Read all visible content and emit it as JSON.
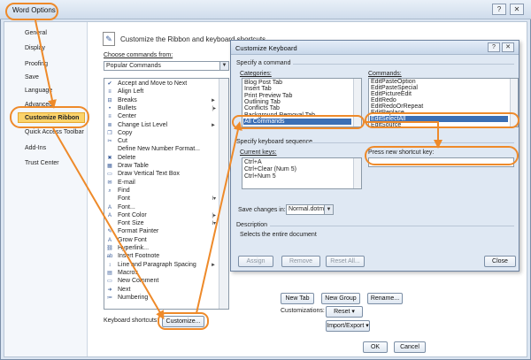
{
  "window": {
    "title": "Word Options",
    "help_glyph": "?",
    "close_glyph": "✕"
  },
  "nav": {
    "items": [
      "General",
      "Display",
      "Proofing",
      "Save",
      "Language",
      "Advanced",
      "Customize Ribbon",
      "Quick Access Toolbar",
      "Add-Ins",
      "Trust Center"
    ],
    "selected": "Customize Ribbon"
  },
  "main": {
    "heading": "Customize the Ribbon and keyboard shortcuts.",
    "choose_label": "Choose commands from:",
    "choose_value": "Popular Commands",
    "commands": [
      {
        "label": "Accept and Move to Next",
        "icon": "accept-icon",
        "glyph": "✔",
        "sub": ""
      },
      {
        "label": "Align Left",
        "icon": "align-left-icon",
        "glyph": "≡",
        "sub": ""
      },
      {
        "label": "Breaks",
        "icon": "breaks-icon",
        "glyph": "⊟",
        "sub": "►"
      },
      {
        "label": "Bullets",
        "icon": "bullets-icon",
        "glyph": "•",
        "sub": "|▸"
      },
      {
        "label": "Center",
        "icon": "center-icon",
        "glyph": "≡",
        "sub": ""
      },
      {
        "label": "Change List Level",
        "icon": "list-level-icon",
        "glyph": "≣",
        "sub": "►"
      },
      {
        "label": "Copy",
        "icon": "copy-icon",
        "glyph": "❐",
        "sub": ""
      },
      {
        "label": "Cut",
        "icon": "cut-icon",
        "glyph": "✂",
        "sub": ""
      },
      {
        "label": "Define New Number Format...",
        "icon": "",
        "glyph": "",
        "sub": ""
      },
      {
        "label": "Delete",
        "icon": "delete-icon",
        "glyph": "✖",
        "sub": ""
      },
      {
        "label": "Draw Table",
        "icon": "draw-table-icon",
        "glyph": "▦",
        "sub": ""
      },
      {
        "label": "Draw Vertical Text Box",
        "icon": "text-box-icon",
        "glyph": "▭",
        "sub": ""
      },
      {
        "label": "E-mail",
        "icon": "email-icon",
        "glyph": "✉",
        "sub": ""
      },
      {
        "label": "Find",
        "icon": "find-icon",
        "glyph": "⌕",
        "sub": ""
      },
      {
        "label": "Font",
        "icon": "",
        "glyph": "",
        "sub": "I▾"
      },
      {
        "label": "Font...",
        "icon": "font-dialog-icon",
        "glyph": "A",
        "sub": ""
      },
      {
        "label": "Font Color",
        "icon": "font-color-icon",
        "glyph": "A",
        "sub": "|▸"
      },
      {
        "label": "Font Size",
        "icon": "",
        "glyph": "",
        "sub": "I▾"
      },
      {
        "label": "Format Painter",
        "icon": "format-painter-icon",
        "glyph": "✎",
        "sub": ""
      },
      {
        "label": "Grow Font",
        "icon": "grow-font-icon",
        "glyph": "A",
        "sub": ""
      },
      {
        "label": "Hyperlink...",
        "icon": "hyperlink-icon",
        "glyph": "⛓",
        "sub": ""
      },
      {
        "label": "Insert Footnote",
        "icon": "footnote-icon",
        "glyph": "ab",
        "sub": ""
      },
      {
        "label": "Line and Paragraph Spacing",
        "icon": "line-spacing-icon",
        "glyph": "↕",
        "sub": "►"
      },
      {
        "label": "Macros",
        "icon": "macros-icon",
        "glyph": "▤",
        "sub": ""
      },
      {
        "label": "New Comment",
        "icon": "new-comment-icon",
        "glyph": "▭",
        "sub": ""
      },
      {
        "label": "Next",
        "icon": "next-icon",
        "glyph": "➜",
        "sub": ""
      },
      {
        "label": "Numbering",
        "icon": "numbering-icon",
        "glyph": "≔",
        "sub": ""
      }
    ],
    "shortcuts_label": "Keyboard shortcuts:",
    "customize_button": "Customize...",
    "new_tab": "New Tab",
    "new_group": "New Group",
    "rename": "Rename...",
    "customizations_label": "Customizations:",
    "reset_button": "Reset ▾",
    "import_export_button": "Import/Export ▾",
    "ok": "OK",
    "cancel": "Cancel"
  },
  "dialog": {
    "title": "Customize Keyboard",
    "help_glyph": "?",
    "close_glyph": "✕",
    "specify_command": "Specify a command",
    "categories_label": "Categories:",
    "categories": [
      "Blog Post Tab",
      "Insert Tab",
      "Print Preview Tab",
      "Outlining Tab",
      "Conflicts Tab",
      "Background Removal Tab",
      "All Commands"
    ],
    "categories_selected": "All Commands",
    "commands_label": "Commands:",
    "commands": [
      "EditPasteOption",
      "EditPasteSpecial",
      "EditPictureEdit",
      "EditRedo",
      "EditRedoOrRepeat",
      "EditReplace",
      "EditSelectAll",
      "EditSource"
    ],
    "commands_selected": "EditSelectAll",
    "specify_sequence": "Specify keyboard sequence",
    "current_keys_label": "Current keys:",
    "current_keys": [
      "Ctrl+A",
      "Ctrl+Clear (Num 5)",
      "Ctrl+Num 5"
    ],
    "press_new_label": "Press new shortcut key:",
    "save_changes_label": "Save changes in:",
    "save_changes_value": "Normal.dotm",
    "description_label": "Description",
    "description_text": "Selects the entire document",
    "assign": "Assign",
    "remove": "Remove",
    "reset_all": "Reset All...",
    "close": "Close"
  }
}
